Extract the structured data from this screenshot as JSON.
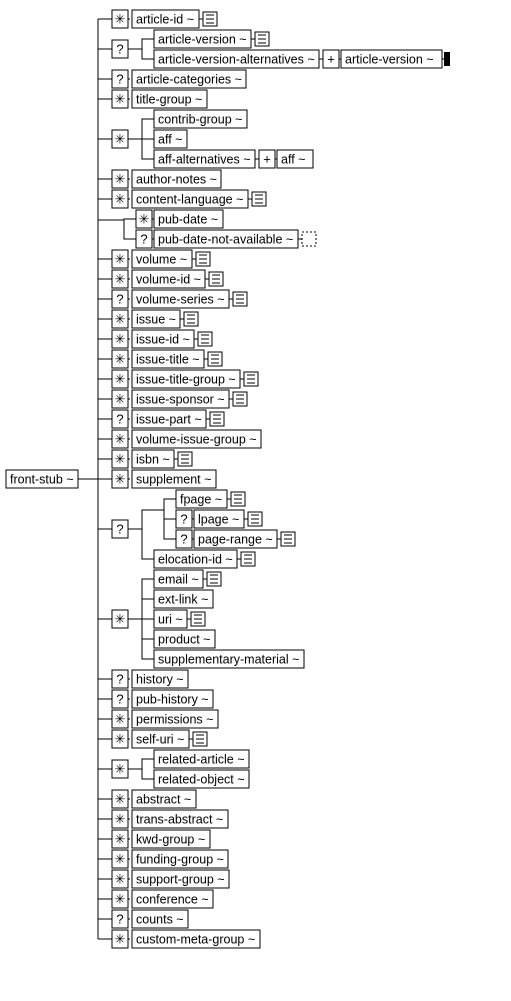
{
  "root": {
    "label": "front-stub ~"
  },
  "symbols": {
    "star": "✳",
    "q": "?",
    "plus": "+",
    "dash": "-"
  },
  "nodes": {
    "article_id": "article-id ~",
    "article_version": "article-version ~",
    "article_version_alt": "article-version-alternatives ~",
    "article_version_tail": " article-version ~",
    "article_categories": "article-categories ~",
    "title_group": "title-group ~",
    "contrib_group": "contrib-group ~",
    "aff": "aff ~",
    "aff_alt": "aff-alternatives ~",
    "aff_tail": " aff ~",
    "author_notes": "author-notes ~",
    "content_language": "content-language ~",
    "pub_date": "pub-date ~",
    "pub_date_na": "pub-date-not-available ~",
    "volume": "volume ~",
    "volume_id": "volume-id ~",
    "volume_series": "volume-series ~",
    "issue": "issue ~",
    "issue_id": "issue-id ~",
    "issue_title": "issue-title ~",
    "issue_title_group": "issue-title-group ~",
    "issue_sponsor": "issue-sponsor ~",
    "issue_part": "issue-part ~",
    "volume_issue_group": "volume-issue-group ~",
    "isbn": "isbn ~",
    "supplement": "supplement ~",
    "fpage": "fpage ~",
    "lpage": "lpage ~",
    "page_range": "page-range ~",
    "elocation_id": "elocation-id ~",
    "email": "email ~",
    "ext_link": "ext-link ~",
    "uri": "uri ~",
    "product": "product ~",
    "supp_material": "supplementary-material ~",
    "history": "history ~",
    "pub_history": "pub-history ~",
    "permissions": "permissions ~",
    "self_uri": "self-uri ~",
    "related_article": "related-article ~",
    "related_object": "related-object ~",
    "abstract": "abstract ~",
    "trans_abstract": "trans-abstract ~",
    "kwd_group": "kwd-group ~",
    "funding_group": "funding-group ~",
    "support_group": "support-group ~",
    "conference": "conference ~",
    "counts": "counts ~",
    "custom_meta_group": "custom-meta-group ~"
  }
}
